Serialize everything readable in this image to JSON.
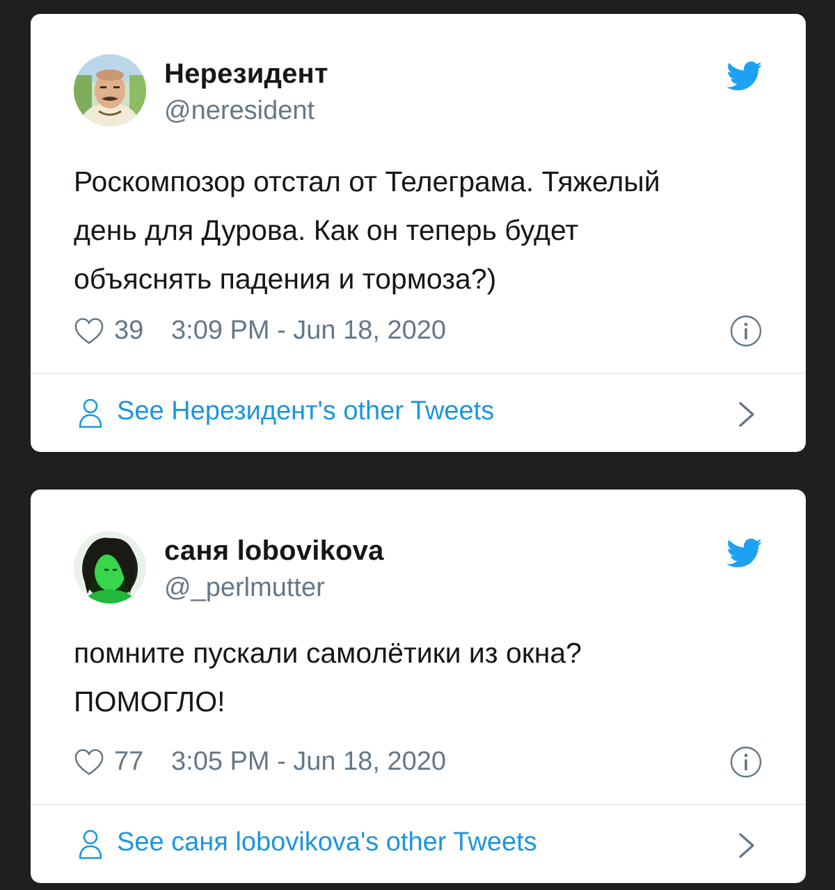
{
  "tweets": [
    {
      "author_name": "Нерезидент",
      "handle": "@neresident",
      "text": "Роскомпозор отстал от Телеграма. Тяжелый\nдень для Дурова. Как он теперь будет\nобъяснять падения и тормоза?)",
      "likes": "39",
      "timestamp": "3:09 PM - Jun 18, 2020",
      "footer_label": "See Нерезидент's other Tweets"
    },
    {
      "author_name": "саня lobovikova",
      "handle": "@_perlmutter",
      "text": "помните пускали самолётики из окна?\nПОМОГЛО!",
      "likes": "77",
      "timestamp": "3:05 PM - Jun 18, 2020",
      "footer_label": "See саня lobovikova's other Tweets"
    }
  ],
  "icons": {
    "brand": "twitter-bird-icon",
    "like": "heart-outline-icon",
    "info": "info-circle-icon",
    "profile": "person-icon",
    "navigate": "chevron-right-icon"
  },
  "colors": {
    "page_background": "#1f1f1f",
    "card_background": "#ffffff",
    "twitter_blue": "#1da1f2",
    "link_blue": "#1b95e0",
    "text_primary": "#14171a",
    "text_secondary": "#657786",
    "divider": "#e6ecf0"
  }
}
